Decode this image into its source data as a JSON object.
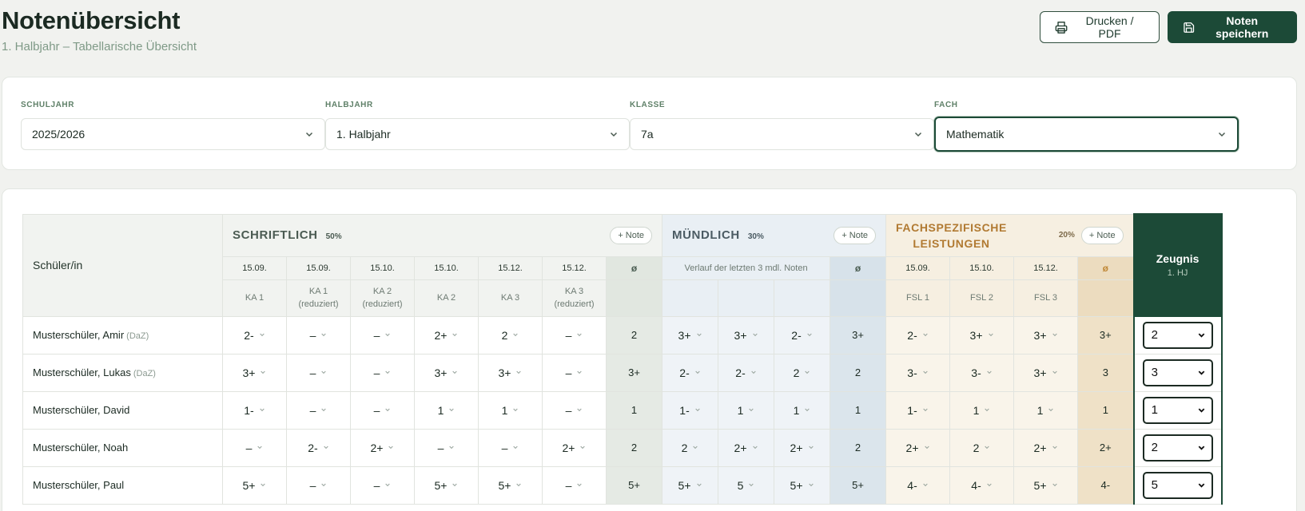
{
  "page": {
    "title": "Notenübersicht",
    "subtitle": "1. Halbjahr – Tabellarische Übersicht"
  },
  "actions": {
    "print_label": "Drucken / PDF",
    "save_label": "Noten speichern"
  },
  "filters": [
    {
      "label": "SCHULJAHR",
      "value": "2025/2026"
    },
    {
      "label": "HALBJAHR",
      "value": "1. Halbjahr"
    },
    {
      "label": "KLASSE",
      "value": "7a"
    },
    {
      "label": "FACH",
      "value": "Mathematik"
    }
  ],
  "table": {
    "student_header": "Schüler/in",
    "add_note_label": "Note",
    "avg_symbol": "ø",
    "groups": {
      "schriftlich": {
        "title": "SCHRIFTLICH",
        "percent": "50%"
      },
      "muendlich": {
        "title": "MÜNDLICH",
        "percent": "30%"
      },
      "fachspezifisch": {
        "title_line1": "FACHSPEZIFISCHE",
        "title_line2": "LEISTUNGEN",
        "percent": "20%"
      }
    },
    "zeugnis": {
      "title": "Zeugnis",
      "subtitle": "1. HJ"
    },
    "schriftlich_columns": [
      {
        "date": "15.09.",
        "type": "KA 1",
        "type2": ""
      },
      {
        "date": "15.09.",
        "type": "KA 1",
        "type2": "(reduziert)"
      },
      {
        "date": "15.10.",
        "type": "KA 2",
        "type2": "(reduziert)"
      },
      {
        "date": "15.10.",
        "type": "KA 2",
        "type2": ""
      },
      {
        "date": "15.12.",
        "type": "KA 3",
        "type2": ""
      },
      {
        "date": "15.12.",
        "type": "KA 3",
        "type2": "(reduziert)"
      }
    ],
    "muendlich_verlauf_label": "Verlauf der letzten 3 mdl. Noten",
    "fsl_columns": [
      {
        "date": "15.09.",
        "type": "FSL 1"
      },
      {
        "date": "15.10.",
        "type": "FSL 2"
      },
      {
        "date": "15.12.",
        "type": "FSL 3"
      }
    ],
    "students": [
      {
        "name": "Musterschüler, Amir",
        "daz": "(DaZ)",
        "schriftlich": [
          "2-",
          "–",
          "–",
          "2+",
          "2",
          "–"
        ],
        "schriftlich_avg": "2",
        "muendlich": [
          "3+",
          "3+",
          "2-"
        ],
        "muendlich_avg": "3+",
        "fsl": [
          "2-",
          "3+",
          "3+"
        ],
        "fsl_avg": "3+",
        "zeugnis": "2"
      },
      {
        "name": "Musterschüler, Lukas",
        "daz": "(DaZ)",
        "schriftlich": [
          "3+",
          "–",
          "–",
          "3+",
          "3+",
          "–"
        ],
        "schriftlich_avg": "3+",
        "muendlich": [
          "2-",
          "2-",
          "2"
        ],
        "muendlich_avg": "2",
        "fsl": [
          "3-",
          "3-",
          "3+"
        ],
        "fsl_avg": "3",
        "zeugnis": "3"
      },
      {
        "name": "Musterschüler, David",
        "daz": "",
        "schriftlich": [
          "1-",
          "–",
          "–",
          "1",
          "1",
          "–"
        ],
        "schriftlich_avg": "1",
        "muendlich": [
          "1-",
          "1",
          "1"
        ],
        "muendlich_avg": "1",
        "fsl": [
          "1-",
          "1",
          "1"
        ],
        "fsl_avg": "1",
        "zeugnis": "1"
      },
      {
        "name": "Musterschüler, Noah",
        "daz": "",
        "schriftlich": [
          "–",
          "2-",
          "2+",
          "–",
          "–",
          "2+"
        ],
        "schriftlich_avg": "2",
        "muendlich": [
          "2",
          "2+",
          "2+"
        ],
        "muendlich_avg": "2",
        "fsl": [
          "2+",
          "2",
          "2+"
        ],
        "fsl_avg": "2+",
        "zeugnis": "2"
      },
      {
        "name": "Musterschüler, Paul",
        "daz": "",
        "schriftlich": [
          "5+",
          "–",
          "–",
          "5+",
          "5+",
          "–"
        ],
        "schriftlich_avg": "5+",
        "muendlich": [
          "5+",
          "5",
          "5+"
        ],
        "muendlich_avg": "5+",
        "fsl": [
          "4-",
          "4-",
          "5+"
        ],
        "fsl_avg": "4-",
        "zeugnis": "5"
      }
    ]
  }
}
